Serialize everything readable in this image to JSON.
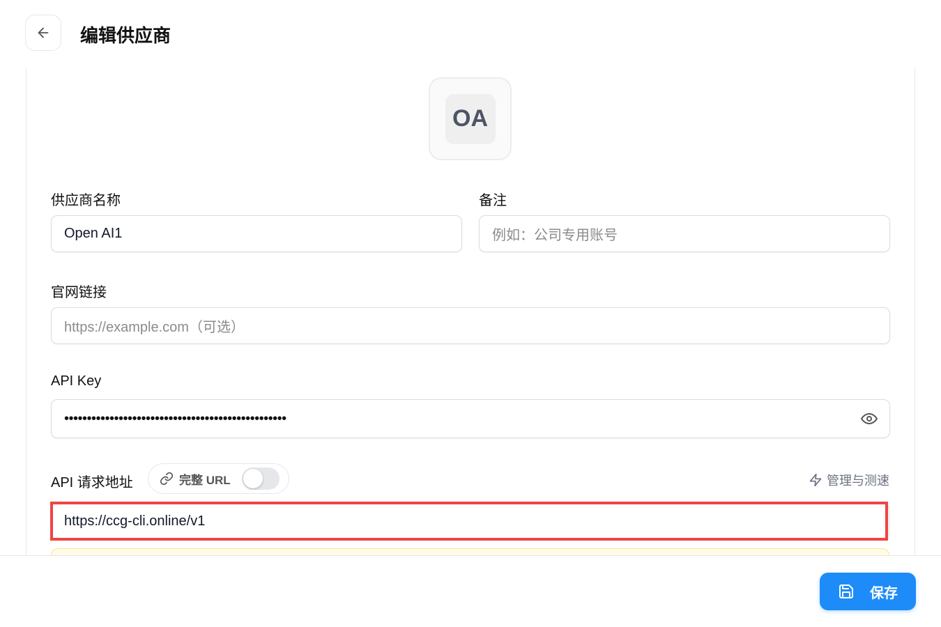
{
  "header": {
    "title": "编辑供应商",
    "back_icon": "arrow-left-icon"
  },
  "avatar": {
    "initials": "OA"
  },
  "form": {
    "provider_name": {
      "label": "供应商名称",
      "value": "Open AI1"
    },
    "note": {
      "label": "备注",
      "placeholder": "例如：公司专用账号",
      "value": ""
    },
    "website": {
      "label": "官网链接",
      "placeholder": "https://example.com（可选）",
      "value": ""
    },
    "api_key": {
      "label": "API Key",
      "masked_value": "•••••••••••••••••••••••••••••••••••••••••••••••••",
      "toggle_icon": "eye-icon"
    },
    "api_url": {
      "label": "API 请求地址",
      "full_url_label": "完整 URL",
      "full_url_enabled": false,
      "manage_label": "管理与测速",
      "value": "https://ccg-cli.online/v1"
    }
  },
  "footer": {
    "save_label": "保存"
  },
  "colors": {
    "primary": "#1d8cf8",
    "highlight": "#ef4444",
    "warning_bg": "#fefce8"
  }
}
